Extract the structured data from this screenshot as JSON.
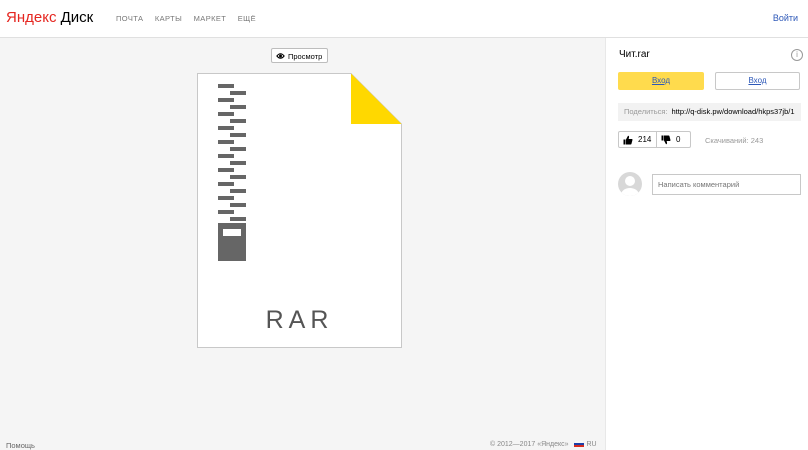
{
  "header": {
    "logo_brand": "Яндекс",
    "logo_product": "Диск",
    "nav": [
      "ПОЧТА",
      "КАРТЫ",
      "МАРКЕТ",
      "ЕЩЁ"
    ],
    "login": "Войти"
  },
  "preview": {
    "button_label": "Просмотр",
    "file_type": "RAR",
    "corner_color": "#ffd800"
  },
  "footer": {
    "help": "Помощь",
    "copyright": "© 2012—2017 «Яндекс»",
    "lang": "RU"
  },
  "sidebar": {
    "filename": "Чит.rar",
    "info_icon": "i",
    "login_primary": "Вход",
    "login_secondary": "Вход",
    "share_label": "Поделиться:",
    "share_url": "http://q-disk.pw/download/hkps37jb/1",
    "likes": "214",
    "dislikes": "0",
    "downloads": "Скачиваний: 243",
    "comment_placeholder": "Написать комментарий"
  },
  "colors": {
    "accent_yellow": "#ffdb4d",
    "link_blue": "#2d58b8",
    "brand_red": "#e52620"
  }
}
